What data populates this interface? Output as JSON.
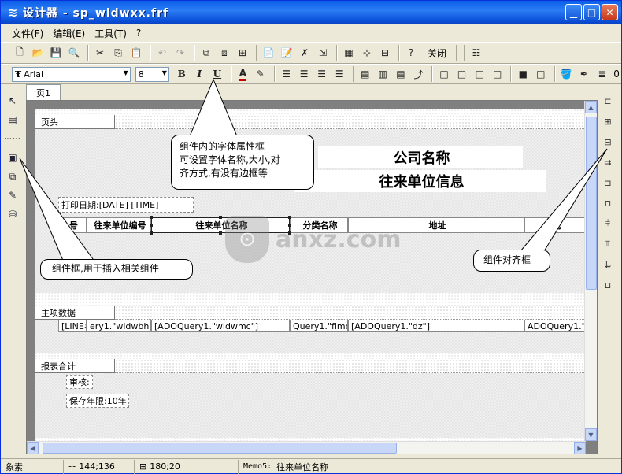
{
  "window": {
    "title": "设计器 - sp_wldwxx.frf"
  },
  "menu": [
    "文件(F)",
    "编辑(E)",
    "工具(T)",
    "?"
  ],
  "toolbar1": {
    "close_label": "关闭"
  },
  "font_toolbar": {
    "font_name": "Arial",
    "font_size": "8",
    "bold": "B",
    "italic": "I",
    "underline": "U",
    "trailing_value": "0"
  },
  "tab": {
    "label": "页1"
  },
  "bands": {
    "page_header": "页头",
    "master_data": "主项数据",
    "report_summary": "报表合计"
  },
  "report": {
    "company_name": "公司名称",
    "report_title": "往来单位信息",
    "print_date": "打印日期:[DATE] [TIME]",
    "headers": [
      "号",
      "往来单位编号",
      "往来单位名称",
      "分类名称",
      "地址",
      "机"
    ],
    "data_fields": [
      "[LINE#]",
      "ery1.\"wldwbh\"",
      "[ADOQuery1.\"wldwmc\"]",
      "Query1.\"flmc\"",
      "[ADOQuery1.\"dz\"]",
      "ADOQuery1.\"dh"
    ],
    "review": "审核:",
    "retention": "保存年限:10年"
  },
  "callouts": {
    "font_box": "组件内的字体属性框\n可设置字体名称,大小,对\n齐方式,有没有边框等",
    "component_box": "组件框,用于插入相关组件",
    "align_box": "组件对齐框"
  },
  "watermark": "anxz.com",
  "status": {
    "mode": "象素",
    "position": "144;136",
    "size": "180;20",
    "selection_prefix": "Memo5:",
    "selection_text": "往来单位名称"
  }
}
